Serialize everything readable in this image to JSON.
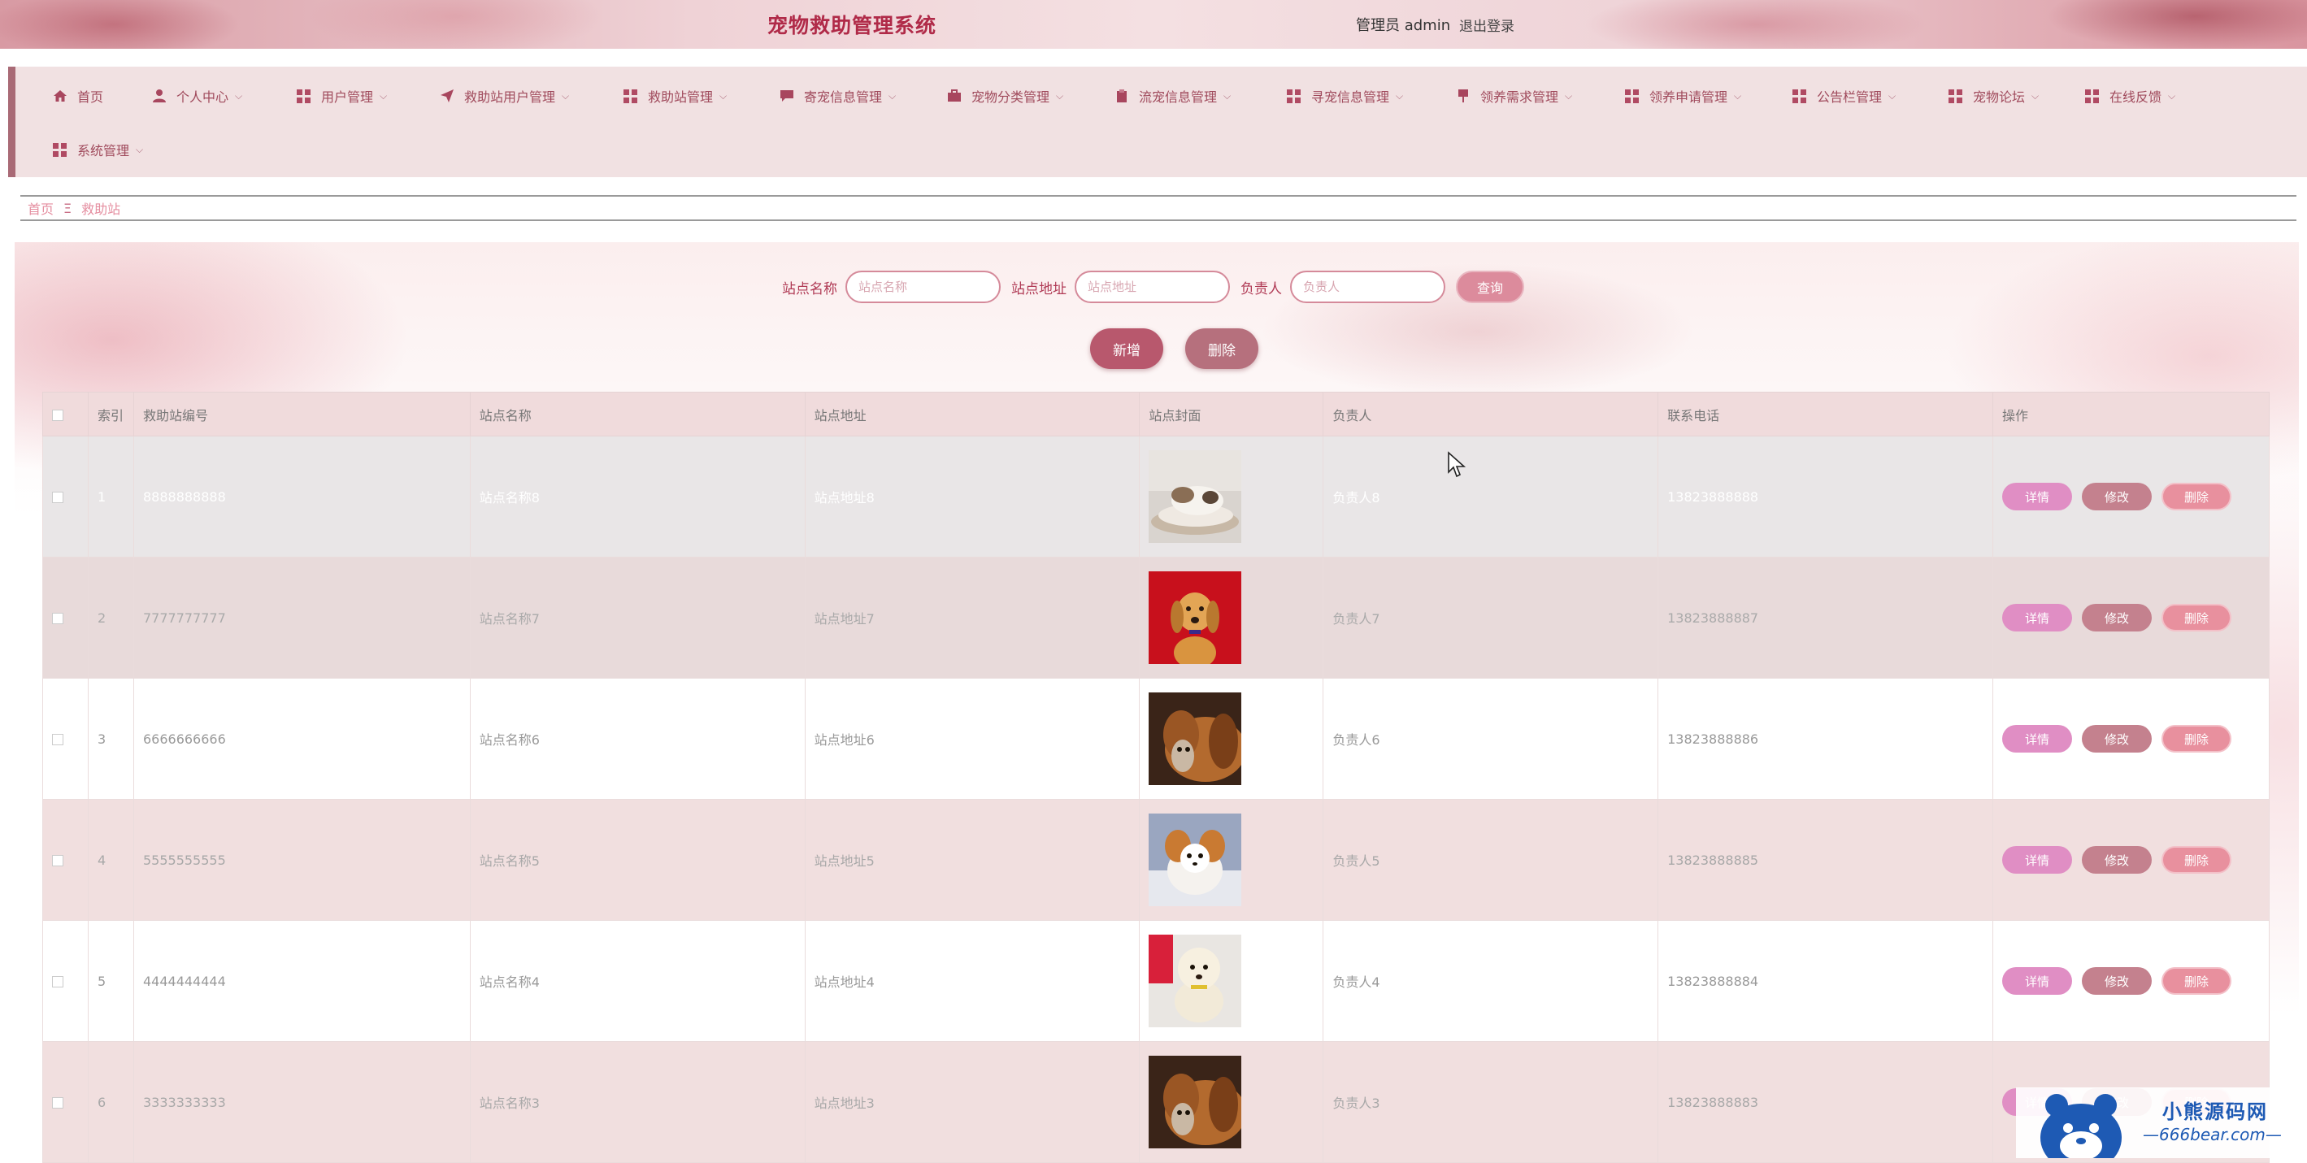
{
  "header": {
    "title": "宠物救助管理系统",
    "user": "管理员 admin",
    "logout": "退出登录"
  },
  "nav": {
    "items": [
      {
        "label": "首页",
        "icon": "home-icon"
      },
      {
        "label": "个人中心",
        "icon": "user-icon"
      },
      {
        "label": "用户管理",
        "icon": "grid-icon"
      },
      {
        "label": "救助站用户管理",
        "icon": "paper-plane-icon"
      },
      {
        "label": "救助站管理",
        "icon": "grid-icon"
      },
      {
        "label": "寄宠信息管理",
        "icon": "comment-icon"
      },
      {
        "label": "宠物分类管理",
        "icon": "briefcase-icon"
      },
      {
        "label": "流宠信息管理",
        "icon": "clipboard-icon"
      },
      {
        "label": "寻宠信息管理",
        "icon": "grid-icon"
      },
      {
        "label": "领养需求管理",
        "icon": "flag-icon"
      },
      {
        "label": "领养申请管理",
        "icon": "grid-icon"
      },
      {
        "label": "公告栏管理",
        "icon": "grid-icon"
      },
      {
        "label": "宠物论坛",
        "icon": "grid-icon"
      },
      {
        "label": "在线反馈",
        "icon": "grid-icon"
      },
      {
        "label": "系统管理",
        "icon": "grid-icon"
      }
    ]
  },
  "breadcrumb": {
    "home": "首页",
    "sep": "Ξ",
    "current": "救助站"
  },
  "search": {
    "name_label": "站点名称",
    "name_placeholder": "站点名称",
    "address_label": "站点地址",
    "address_placeholder": "站点地址",
    "manager_label": "负责人",
    "manager_placeholder": "负责人",
    "query_button": "查询"
  },
  "actions": {
    "add_button": "新增",
    "delete_button": "删除"
  },
  "table": {
    "columns": [
      "索引",
      "救助站编号",
      "站点名称",
      "站点地址",
      "站点封面",
      "负责人",
      "联系电话",
      "操作"
    ],
    "row_buttons": {
      "detail": "详情",
      "edit": "修改",
      "remove": "删除"
    },
    "rows": [
      {
        "index": "1",
        "code": "8888888888",
        "name": "站点名称8",
        "address": "站点地址8",
        "cover": "dog-cat-lying-photo",
        "manager": "负责人8",
        "phone": "13823888888"
      },
      {
        "index": "2",
        "code": "7777777777",
        "name": "站点名称7",
        "address": "站点地址7",
        "cover": "golden-retriever-red-photo",
        "manager": "负责人7",
        "phone": "13823888887"
      },
      {
        "index": "3",
        "code": "6666666666",
        "name": "站点名称6",
        "address": "站点地址6",
        "cover": "bloodhound-kitten-photo",
        "manager": "负责人6",
        "phone": "13823888886"
      },
      {
        "index": "4",
        "code": "5555555555",
        "name": "站点名称5",
        "address": "站点地址5",
        "cover": "papillon-dog-photo",
        "manager": "负责人5",
        "phone": "13823888885"
      },
      {
        "index": "5",
        "code": "4444444444",
        "name": "站点名称4",
        "address": "站点地址4",
        "cover": "poodle-puppy-photo",
        "manager": "负责人4",
        "phone": "13823888884"
      },
      {
        "index": "6",
        "code": "3333333333",
        "name": "站点名称3",
        "address": "站点地址3",
        "cover": "bloodhound-kitten-photo",
        "manager": "负责人3",
        "phone": "13823888883"
      }
    ]
  },
  "watermark": {
    "line1": "小熊源码网",
    "line2": "—666bear.com—"
  },
  "colors": {
    "accent": "#b02a48",
    "nav_bg": "#f1e1e2",
    "detail_button": "#e08ec4",
    "edit_button": "#c4818e",
    "remove_button": "#e8909e"
  }
}
